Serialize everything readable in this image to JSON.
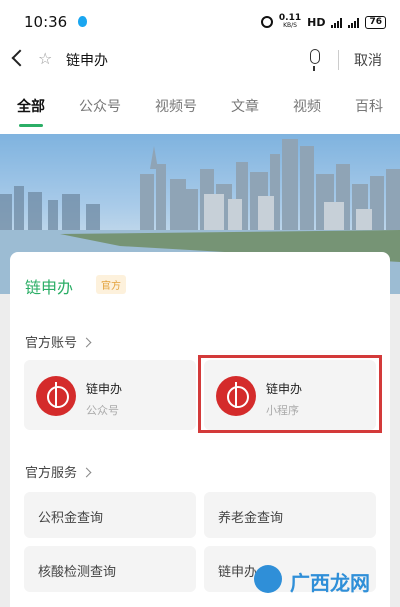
{
  "status": {
    "time": "10:36",
    "speed": "0.11",
    "speed_unit": "KB/S",
    "network": "HD",
    "battery": "76"
  },
  "search": {
    "query": "链申办",
    "cancel": "取消"
  },
  "tabs": [
    "全部",
    "公众号",
    "视频号",
    "文章",
    "视频",
    "百科"
  ],
  "result": {
    "title": "链申办",
    "badge": "官方",
    "accounts_header": "官方账号",
    "accounts": [
      {
        "name": "链申办",
        "type": "公众号"
      },
      {
        "name": "链申办",
        "type": "小程序"
      }
    ],
    "services_header": "官方服务",
    "services": [
      "公积金查询",
      "养老金查询",
      "核酸检测查询",
      "链申办"
    ]
  },
  "watermark": "广西龙网"
}
